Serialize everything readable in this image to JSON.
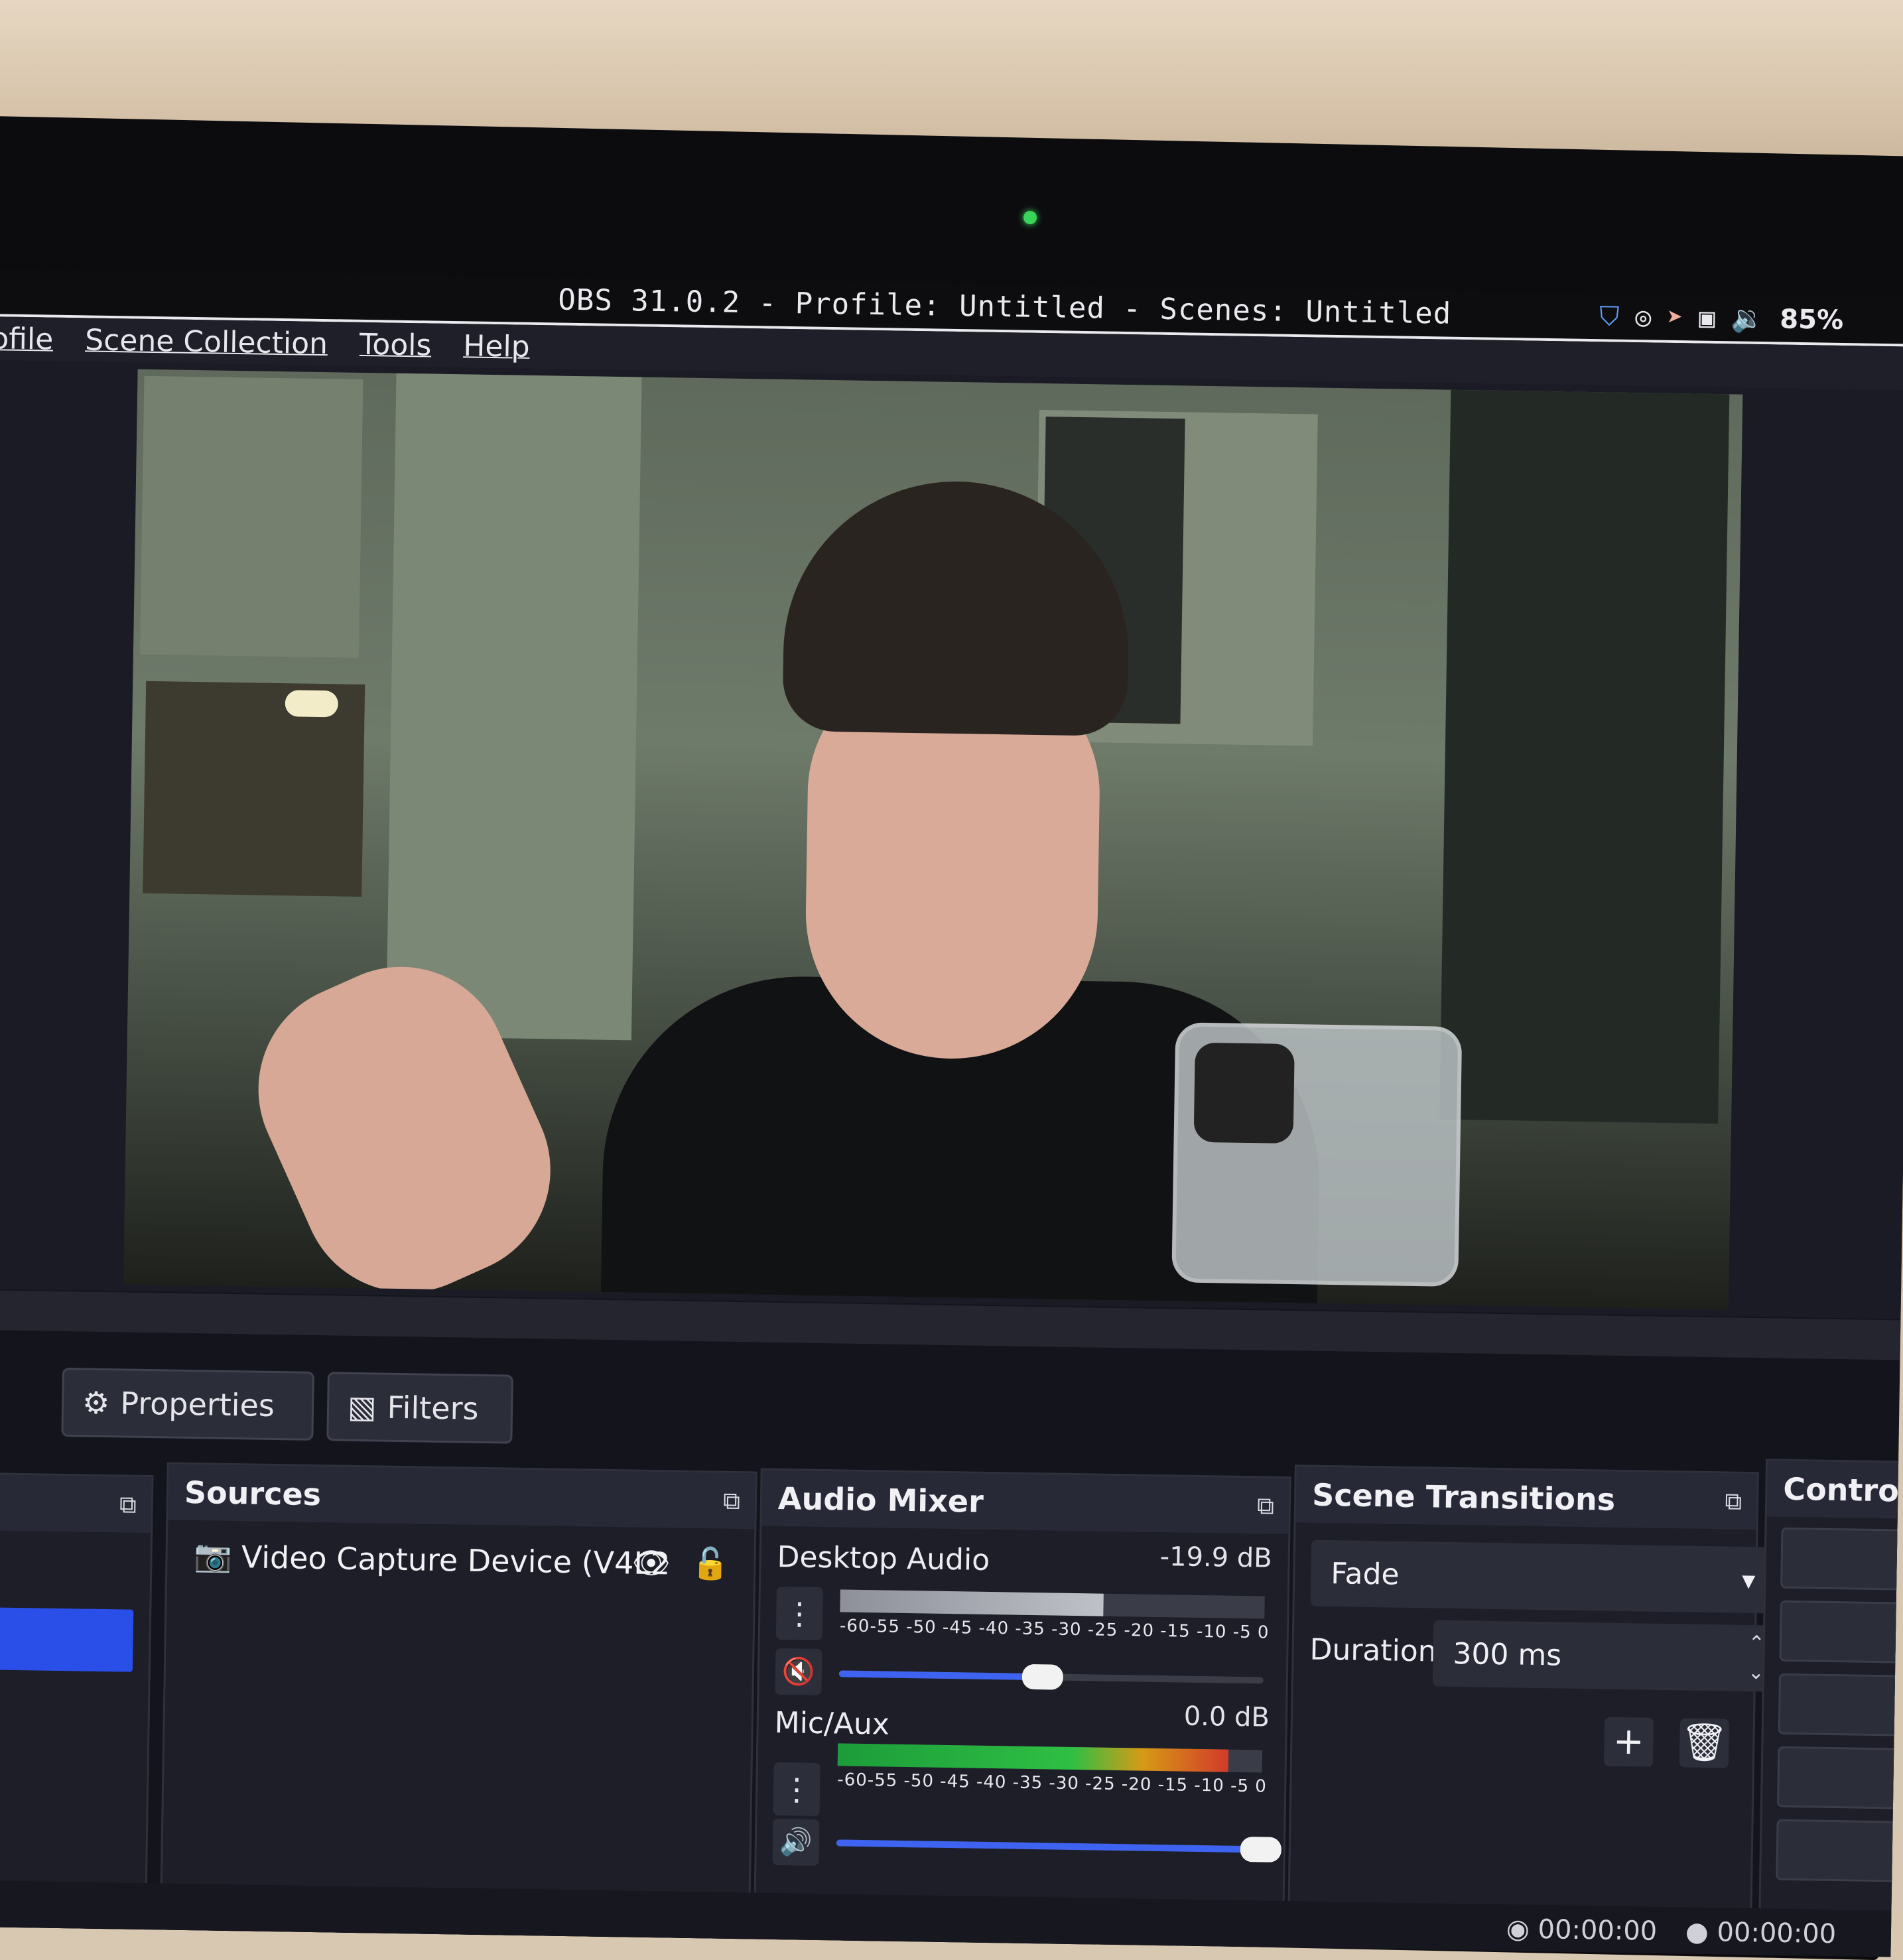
{
  "window": {
    "title": "OBS 31.0.2 - Profile: Untitled - Scenes: Untitled",
    "tray": {
      "icons": [
        "shield-check-icon",
        "obs-icon",
        "send-icon",
        "screen-icon",
        "volume-icon"
      ],
      "battery": "85%"
    }
  },
  "menubar": {
    "items": [
      "ofile",
      "Scene Collection",
      "Tools",
      "Help"
    ]
  },
  "buttons": {
    "properties": "Properties",
    "filters": "Filters"
  },
  "sources": {
    "title": "Sources",
    "items": [
      {
        "label": "Video Capture Device (V4L2"
      }
    ]
  },
  "audio_mixer": {
    "title": "Audio Mixer",
    "scale": "-60-55 -50 -45 -40 -35 -30 -25 -20 -15 -10  -5  0",
    "channels": [
      {
        "name": "Desktop Audio",
        "db": "-19.9 dB",
        "muted": true,
        "level": 0.62,
        "volume": 0.48
      },
      {
        "name": "Mic/Aux",
        "db": "0.0 dB",
        "muted": false,
        "level": 0.92,
        "volume": 1.0
      }
    ]
  },
  "scene_transitions": {
    "title": "Scene Transitions",
    "selected": "Fade",
    "duration_label": "Duration",
    "duration_value": "300 ms"
  },
  "controls": {
    "title": "Controls"
  },
  "status": {
    "time1": "00:00:00",
    "time2": "00:00:00"
  },
  "colors": {
    "accent": "#2a4ee8",
    "panel": "#1d1e27",
    "mute_red": "#e0443a"
  }
}
